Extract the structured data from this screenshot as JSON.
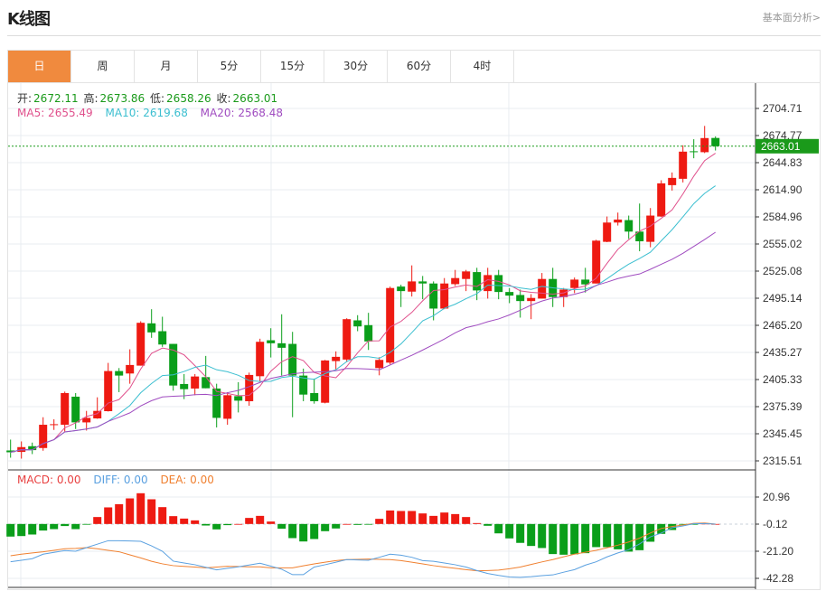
{
  "header": {
    "title": "K线图",
    "more_link": "基本面分析>"
  },
  "tabs": [
    {
      "label": "日",
      "active": true
    },
    {
      "label": "周"
    },
    {
      "label": "月"
    },
    {
      "label": "5分"
    },
    {
      "label": "15分"
    },
    {
      "label": "30分"
    },
    {
      "label": "60分"
    },
    {
      "label": "4时"
    }
  ],
  "ohlc_legend": {
    "open_label": "开:",
    "open": "2672.11",
    "high_label": "高:",
    "high": "2673.86",
    "low_label": "低:",
    "low": "2658.26",
    "close_label": "收:",
    "close": "2663.01"
  },
  "ma_legend": {
    "ma5": "MA5: 2655.49",
    "ma10": "MA10: 2619.68",
    "ma20": "MA20: 2568.48"
  },
  "macd_legend": {
    "macd": "MACD: 0.00",
    "diff": "DIFF: 0.00",
    "dea": "DEA: 0.00"
  },
  "colors": {
    "up": "#ee1a12",
    "down": "#0a9e1a",
    "ma5": "#e0508c",
    "ma10": "#3cbfd0",
    "ma20": "#a04cc0",
    "macd": "#e84040",
    "diff": "#5aa0e0",
    "dea": "#f08030",
    "accent": "#f08a3e",
    "price_line": "#1a9a1a"
  },
  "chart_data": [
    {
      "type": "candlestick",
      "price_axis": {
        "ticks": [
          "2704.71",
          "2674.77",
          "2644.83",
          "2614.90",
          "2584.96",
          "2555.02",
          "2525.08",
          "2495.14",
          "2465.20",
          "2435.27",
          "2405.33",
          "2375.39",
          "2345.45",
          "2315.51"
        ],
        "range": [
          2315.51,
          2704.71
        ],
        "position": "right",
        "grid": true
      },
      "current_price": "2663.01",
      "moving_averages": [
        "MA5",
        "MA10",
        "MA20"
      ],
      "candles": [
        [
          2327,
          2339,
          2319,
          2325
        ],
        [
          2325.4,
          2337,
          2318,
          2330.7
        ],
        [
          2331.7,
          2335.7,
          2323,
          2327.4
        ],
        [
          2329.7,
          2363.7,
          2326.7,
          2355.4
        ],
        [
          2355,
          2361.4,
          2349.7,
          2356
        ],
        [
          2355.4,
          2392,
          2348,
          2390.4
        ],
        [
          2386.4,
          2390.4,
          2350.7,
          2358
        ],
        [
          2358,
          2370.7,
          2349,
          2363
        ],
        [
          2362.4,
          2385.7,
          2362,
          2370.7
        ],
        [
          2370.4,
          2423.7,
          2370,
          2414.7
        ],
        [
          2414.7,
          2418,
          2391.4,
          2409.7
        ],
        [
          2412,
          2438.7,
          2400.7,
          2421.4
        ],
        [
          2420.7,
          2469.7,
          2420.7,
          2468
        ],
        [
          2467.4,
          2483,
          2451.4,
          2457.4
        ],
        [
          2458.7,
          2474.7,
          2441.4,
          2444
        ],
        [
          2444.7,
          2444.7,
          2393,
          2398.7
        ],
        [
          2400.4,
          2411.4,
          2383.7,
          2394.7
        ],
        [
          2395.4,
          2411.4,
          2388,
          2408.7
        ],
        [
          2408,
          2431.4,
          2395.7,
          2395.7
        ],
        [
          2395.4,
          2400.7,
          2352.4,
          2363
        ],
        [
          2362,
          2391.4,
          2355.4,
          2388
        ],
        [
          2387,
          2402.4,
          2369,
          2382
        ],
        [
          2381.4,
          2413,
          2376.4,
          2410.4
        ],
        [
          2409,
          2450.4,
          2403,
          2447
        ],
        [
          2448.7,
          2462,
          2429.7,
          2445.4
        ],
        [
          2445.4,
          2477.4,
          2409.7,
          2440.4
        ],
        [
          2444.7,
          2458,
          2363.7,
          2409.7
        ],
        [
          2409.7,
          2417.4,
          2381.4,
          2388.7
        ],
        [
          2390.4,
          2406.4,
          2378.7,
          2381.4
        ],
        [
          2379.7,
          2427,
          2379,
          2426.4
        ],
        [
          2425.7,
          2436.4,
          2416.4,
          2430.4
        ],
        [
          2427.4,
          2473,
          2424.7,
          2472
        ],
        [
          2470.7,
          2476.4,
          2458.7,
          2464
        ],
        [
          2465.4,
          2479,
          2438,
          2447.4
        ],
        [
          2418,
          2430,
          2410,
          2427
        ],
        [
          2424,
          2508,
          2422,
          2506.4
        ],
        [
          2508,
          2510,
          2485.4,
          2503
        ],
        [
          2502.4,
          2531.4,
          2497,
          2513.7
        ],
        [
          2513.7,
          2519.7,
          2494,
          2511.4
        ],
        [
          2511.4,
          2513.7,
          2470.7,
          2483.7
        ],
        [
          2483.7,
          2517.4,
          2483,
          2511.4
        ],
        [
          2510.7,
          2526.4,
          2508.7,
          2517.4
        ],
        [
          2516.4,
          2526.4,
          2503,
          2524.7
        ],
        [
          2524,
          2528.7,
          2493,
          2503.7
        ],
        [
          2503,
          2528.7,
          2494.7,
          2520.7
        ],
        [
          2520.7,
          2526.4,
          2494,
          2502
        ],
        [
          2502,
          2506.4,
          2489.7,
          2498
        ],
        [
          2498.7,
          2504.7,
          2473.7,
          2492
        ],
        [
          2492,
          2499.7,
          2472,
          2495.4
        ],
        [
          2494.7,
          2523,
          2494.7,
          2516.4
        ],
        [
          2516.4,
          2528.7,
          2485.4,
          2496.4
        ],
        [
          2496.4,
          2506.4,
          2485.4,
          2504.7
        ],
        [
          2506.4,
          2518,
          2500.7,
          2515.7
        ],
        [
          2515.7,
          2528.7,
          2501.4,
          2510.4
        ],
        [
          2511.4,
          2559.7,
          2511.4,
          2558.7
        ],
        [
          2557.4,
          2585.4,
          2557,
          2578.7
        ],
        [
          2578.7,
          2589.7,
          2575.4,
          2582
        ],
        [
          2581.4,
          2586.4,
          2560.7,
          2568.7
        ],
        [
          2568.7,
          2599.7,
          2547,
          2558
        ],
        [
          2557.4,
          2594.7,
          2551.4,
          2586.4
        ],
        [
          2585.4,
          2625.4,
          2585,
          2622
        ],
        [
          2620,
          2634,
          2614,
          2628
        ],
        [
          2627,
          2664,
          2623,
          2657
        ],
        [
          2657.4,
          2670.7,
          2649.7,
          2656.4
        ],
        [
          2656.4,
          2685.4,
          2655.4,
          2672
        ],
        [
          2672.11,
          2673.86,
          2658.26,
          2663.01
        ]
      ]
    },
    {
      "type": "macd",
      "axis": {
        "ticks": [
          "20.96",
          "-0.12",
          "-21.20",
          "-42.28"
        ],
        "range": [
          -42.28,
          20.96
        ],
        "position": "right",
        "grid": true
      },
      "macd": [
        -9.8,
        -9.4,
        -8.2,
        -5.1,
        -4.0,
        -1.6,
        -4.0,
        -0.3,
        5.4,
        12.9,
        15.4,
        19.9,
        23.9,
        19.2,
        13.1,
        6.1,
        4.2,
        2.8,
        -1.2,
        -4.2,
        -0.9,
        0,
        4.7,
        6.3,
        1.9,
        -3.7,
        -11.0,
        -13.6,
        -11.7,
        -5.6,
        -3.5,
        0,
        -0.7,
        -0.5,
        4.0,
        10.5,
        10.1,
        10.1,
        8.2,
        6.3,
        8.9,
        7.7,
        5.4,
        0.7,
        -1.4,
        -7.3,
        -11.2,
        -14.7,
        -17.1,
        -18.7,
        -23.4,
        -23.9,
        -23.6,
        -22.7,
        -18.0,
        -18.0,
        -19.7,
        -21.5,
        -20.4,
        -13.8,
        -7.7,
        -4.7,
        -0.5,
        -0.2,
        0.3,
        0
      ],
      "diff": [
        -29.4,
        -28.2,
        -27.0,
        -23.5,
        -22.1,
        -20.7,
        -21.2,
        -18.4,
        -15.7,
        -13.0,
        -13.0,
        -13.2,
        -13.5,
        -17,
        -21.2,
        -28.9,
        -30.3,
        -31.7,
        -33.7,
        -35.7,
        -34.5,
        -33.3,
        -31.9,
        -30.5,
        -32.8,
        -35.2,
        -39.4,
        -39.4,
        -33.5,
        -31.7,
        -29.7,
        -27.7,
        -28,
        -28.2,
        -25.9,
        -23.5,
        -24.3,
        -25.9,
        -28.5,
        -29,
        -30.3,
        -31.7,
        -33.5,
        -36.2,
        -38.5,
        -40,
        -41.2,
        -41.5,
        -41,
        -40.2,
        -39.6,
        -37.5,
        -35.5,
        -32,
        -29.4,
        -25.6,
        -22.5,
        -20.0,
        -15.5,
        -10,
        -7.1,
        -2.9,
        -1.5,
        0.2,
        0.35,
        -0.12
      ],
      "dea": [
        -24.7,
        -23.5,
        -22.5,
        -21.6,
        -20.5,
        -19.3,
        -19,
        -18.4,
        -19.3,
        -20.5,
        -21.6,
        -24,
        -26.4,
        -29,
        -31.0,
        -32.4,
        -33,
        -33.5,
        -34.1,
        -33.5,
        -32.9,
        -33.1,
        -33.3,
        -33.3,
        -34.1,
        -34.1,
        -34.1,
        -32.5,
        -31,
        -29.7,
        -28.5,
        -27.7,
        -27.5,
        -27.3,
        -27.5,
        -27.7,
        -28.5,
        -29.7,
        -31,
        -32.4,
        -33.5,
        -34.5,
        -35.5,
        -36.4,
        -36.2,
        -35.9,
        -34.8,
        -33.5,
        -31.5,
        -29.5,
        -27.7,
        -25.5,
        -23.5,
        -22,
        -20.5,
        -18.5,
        -16.5,
        -14,
        -11,
        -7,
        -3.5,
        -2.0,
        -0.8,
        0.5,
        0.8,
        -0.12
      ]
    }
  ]
}
